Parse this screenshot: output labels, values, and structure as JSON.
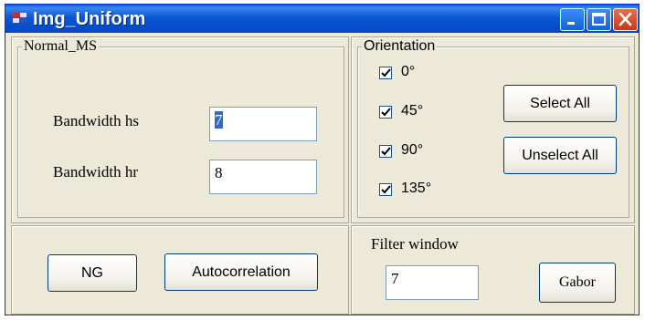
{
  "window": {
    "title": "Img_Uniform",
    "icons": {
      "app": "app-icon",
      "minimize": "minimize-icon",
      "maximize": "maximize-icon",
      "close": "close-icon"
    }
  },
  "normal_ms": {
    "legend": "Normal_MS",
    "bandwidth_hs_label": "Bandwidth hs",
    "bandwidth_hs_value": "7",
    "bandwidth_hr_label": "Bandwidth hr",
    "bandwidth_hr_value": "8"
  },
  "orientation": {
    "legend": "Orientation",
    "options": [
      {
        "label": "0°",
        "checked": true
      },
      {
        "label": "45°",
        "checked": true
      },
      {
        "label": "90°",
        "checked": true
      },
      {
        "label": "135°",
        "checked": true
      }
    ],
    "select_all_label": "Select All",
    "unselect_all_label": "Unselect All"
  },
  "actions": {
    "ng_label": "NG",
    "autocorrelation_label": "Autocorrelation"
  },
  "filter": {
    "label": "Filter window",
    "value": "7",
    "gabor_label": "Gabor"
  }
}
